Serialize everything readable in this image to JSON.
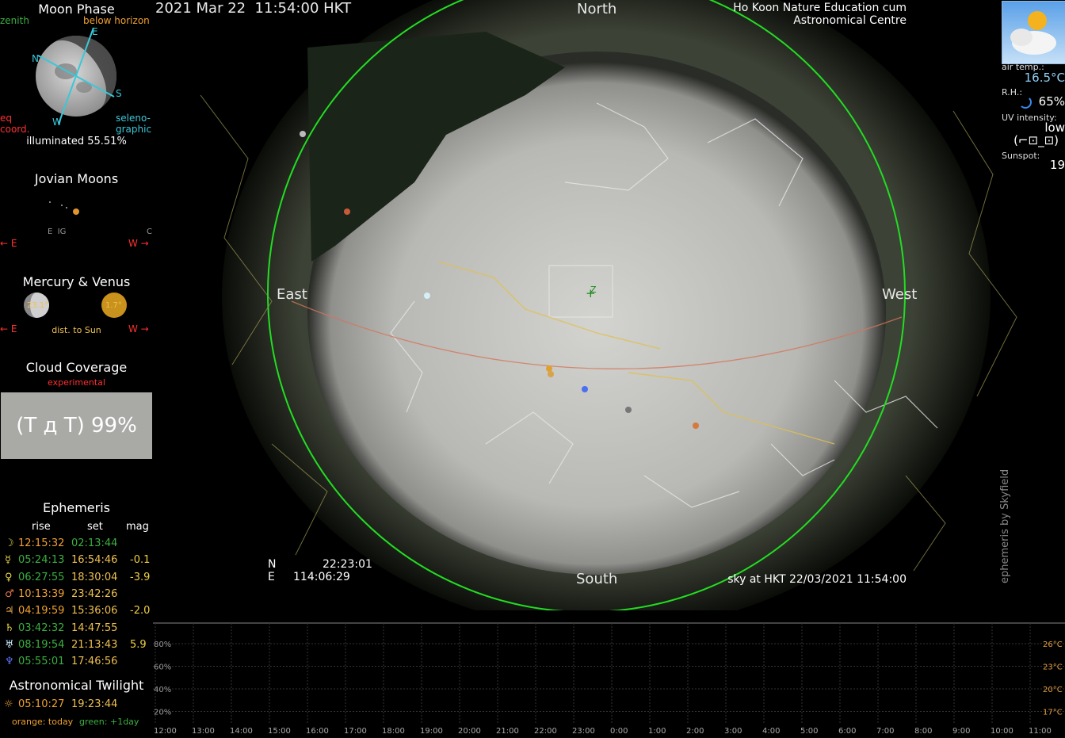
{
  "moon_phase": {
    "title": "Moon Phase",
    "zenith": "zenith",
    "below_horizon": "below horizon",
    "eq_coord_1": "eq",
    "eq_coord_2": "coord.",
    "seleno_1": "seleno-",
    "seleno_2": "graphic",
    "compass_n": "N",
    "compass_e": "E",
    "compass_s": "S",
    "compass_w": "W",
    "illuminated": "illuminated 55.51%"
  },
  "jovian": {
    "title": "Jovian Moons",
    "moon_labels": "E  IG",
    "moon_c": "C",
    "east": "← E",
    "west": "W →"
  },
  "mercury_venus": {
    "title": "Mercury & Venus",
    "mercury_angle": "23.1°",
    "venus_angle": "1.7°",
    "east": "← E",
    "dist": "dist. to Sun",
    "west": "W →"
  },
  "cloud": {
    "title": "Cloud Coverage",
    "subtitle": "experimental",
    "value": "(T д T) 99%"
  },
  "ephemeris": {
    "title": "Ephemeris",
    "col_rise": "rise",
    "col_set": "set",
    "col_mag": "mag",
    "rows": [
      {
        "sym": "☽",
        "color": "#e8d84a",
        "rise": "12:15:32",
        "set": "02:13:44",
        "mag": ""
      },
      {
        "sym": "☿",
        "color": "#e8d84a",
        "rise": "05:24:13",
        "set": "16:54:46",
        "mag": "-0.1"
      },
      {
        "sym": "♀",
        "color": "#e8d84a",
        "rise": "06:27:55",
        "set": "18:30:04",
        "mag": "-3.9"
      },
      {
        "sym": "♂",
        "color": "#e8734a",
        "rise": "10:13:39",
        "set": "23:42:26",
        "mag": ""
      },
      {
        "sym": "♃",
        "color": "#e8a44a",
        "rise": "04:19:59",
        "set": "15:36:06",
        "mag": "-2.0"
      },
      {
        "sym": "♄",
        "color": "#e8d84a",
        "rise": "03:42:32",
        "set": "14:47:55",
        "mag": ""
      },
      {
        "sym": "♅",
        "color": "#c8e8f8",
        "rise": "08:19:54",
        "set": "21:13:43",
        "mag": "5.9"
      },
      {
        "sym": "♆",
        "color": "#5a6ff0",
        "rise": "05:55:01",
        "set": "17:46:56",
        "mag": ""
      }
    ],
    "twilight_title": "Astronomical Twilight",
    "twilight_sym": "☼",
    "twilight_rise": "05:10:27",
    "twilight_set": "19:23:44",
    "legend_orange": "orange: today",
    "legend_green": "green: +1day",
    "rise_color": "#f0a030",
    "set_color": "#3bb040"
  },
  "sky": {
    "datetime": "2021 Mar 22  11:54:00 HKT",
    "location_1": "Ho Koon Nature Education cum",
    "location_2": "Astronomical Centre",
    "north": "North",
    "south": "South",
    "east": "East",
    "west": "West",
    "coord_n_label": "N",
    "coord_n_value": "22:23:01",
    "coord_e_label": "E",
    "coord_e_value": "114:06:29",
    "sky_time": "sky at HKT 22/03/2021 11:54:00",
    "credit": "ephemeris by Skyfield",
    "zenith_mark": "Z",
    "horizon_color": "#22dd22"
  },
  "weather": {
    "air_temp_label": "air temp.:",
    "air_temp": "16.5°C",
    "rh_label": "R.H.:",
    "rh": "65%",
    "uv_label": "UV intensity:",
    "uv": "low",
    "uv_face": "(⌐⊡_⊡)",
    "sunspot_label": "Sunspot:",
    "sunspot": "19"
  },
  "graph": {
    "left_ticks": [
      "80%",
      "60%",
      "40%",
      "20%"
    ],
    "right_ticks": [
      "26°C",
      "23°C",
      "20°C",
      "17°C"
    ],
    "hours": [
      "12:00",
      "13:00",
      "14:00",
      "15:00",
      "16:00",
      "17:00",
      "18:00",
      "19:00",
      "20:00",
      "21:00",
      "22:00",
      "23:00",
      "0:00",
      "1:00",
      "2:00",
      "3:00",
      "4:00",
      "5:00",
      "6:00",
      "7:00",
      "8:00",
      "9:00",
      "10:00",
      "11:00"
    ]
  }
}
